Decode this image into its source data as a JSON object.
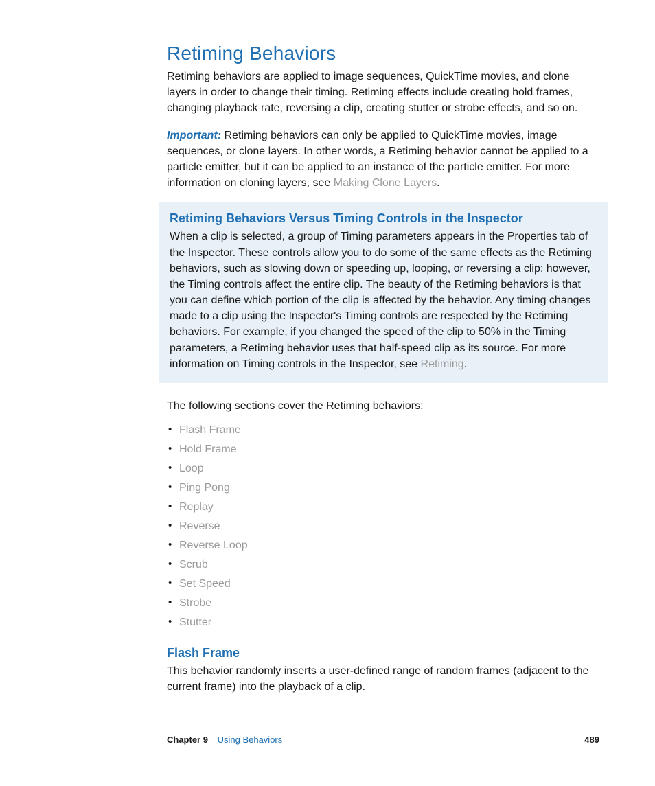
{
  "section": {
    "title": "Retiming Behaviors",
    "intro": "Retiming behaviors are applied to image sequences, QuickTime movies, and clone layers in order to change their timing. Retiming effects include creating hold frames, changing playback rate, reversing a clip, creating stutter or strobe effects, and so on.",
    "important_label": "Important:",
    "important_text_1": "  Retiming behaviors can only be applied to QuickTime movies, image sequences, or clone layers. In other words, a Retiming behavior cannot be applied to a particle emitter, but it can be applied to an instance of the particle emitter. For more information on cloning layers, see ",
    "important_link": "Making Clone Layers",
    "important_text_2": "."
  },
  "callout": {
    "title": "Retiming Behaviors Versus Timing Controls in the Inspector",
    "body_1": "When a clip is selected, a group of Timing parameters appears in the Properties tab of the Inspector. These controls allow you to do some of the same effects as the Retiming behaviors, such as slowing down or speeding up, looping, or reversing a clip; however, the Timing controls affect the entire clip. The beauty of the Retiming behaviors is that you can define which portion of the clip is affected by the behavior. Any timing changes made to a clip using the Inspector's Timing controls are respected by the Retiming behaviors. For example, if you changed the speed of the clip to 50% in the Timing parameters, a Retiming behavior uses that half-speed clip as its source. For more information on Timing controls in the Inspector, see ",
    "body_link": "Retiming",
    "body_2": "."
  },
  "list_intro": "The following sections cover the Retiming behaviors:",
  "behaviors": [
    "Flash Frame",
    "Hold Frame",
    "Loop",
    "Ping Pong",
    "Replay",
    "Reverse",
    "Reverse Loop",
    "Scrub",
    "Set Speed",
    "Strobe",
    "Stutter"
  ],
  "subsection": {
    "title": "Flash Frame",
    "body": "This behavior randomly inserts a user-defined range of random frames (adjacent to the current frame) into the playback of a clip."
  },
  "footer": {
    "chapter_label": "Chapter 9",
    "chapter_name": "Using Behaviors",
    "page": "489"
  }
}
